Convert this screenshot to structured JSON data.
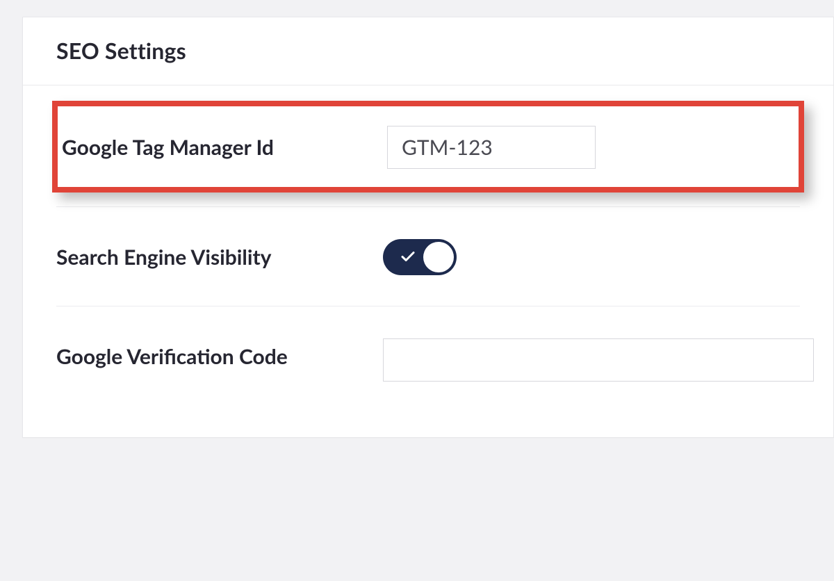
{
  "panel": {
    "title": "SEO Settings"
  },
  "fields": {
    "gtm": {
      "label": "Google Tag Manager Id",
      "value": "GTM-123"
    },
    "visibility": {
      "label": "Search Engine Visibility",
      "on": true
    },
    "gvc": {
      "label": "Google Verification Code",
      "value": ""
    }
  },
  "annotation": {
    "highlight_color": "#e04438"
  }
}
